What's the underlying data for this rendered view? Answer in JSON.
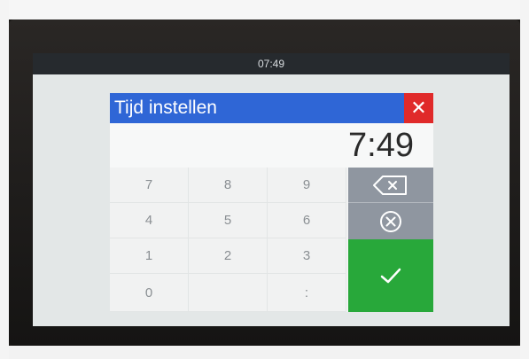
{
  "statusbar": {
    "time": "07:49"
  },
  "dialog": {
    "title": "Tijd instellen",
    "close_symbol": "✕",
    "display_value": "7:49",
    "keys": [
      {
        "label": "7"
      },
      {
        "label": "8"
      },
      {
        "label": "9"
      },
      {
        "label": "4"
      },
      {
        "label": "5"
      },
      {
        "label": "6"
      },
      {
        "label": "1"
      },
      {
        "label": "2"
      },
      {
        "label": "3"
      },
      {
        "label": "0"
      },
      {
        "label": ""
      },
      {
        "label": ":"
      }
    ],
    "icons": {
      "close": "close-icon",
      "backspace": "backspace-icon",
      "clear": "clear-circle-icon",
      "confirm": "checkmark-icon"
    },
    "colors": {
      "title_bar": "#2f66d6",
      "close": "#e02a2a",
      "action_gray": "#8f96a0",
      "confirm_green": "#28a83a"
    }
  }
}
